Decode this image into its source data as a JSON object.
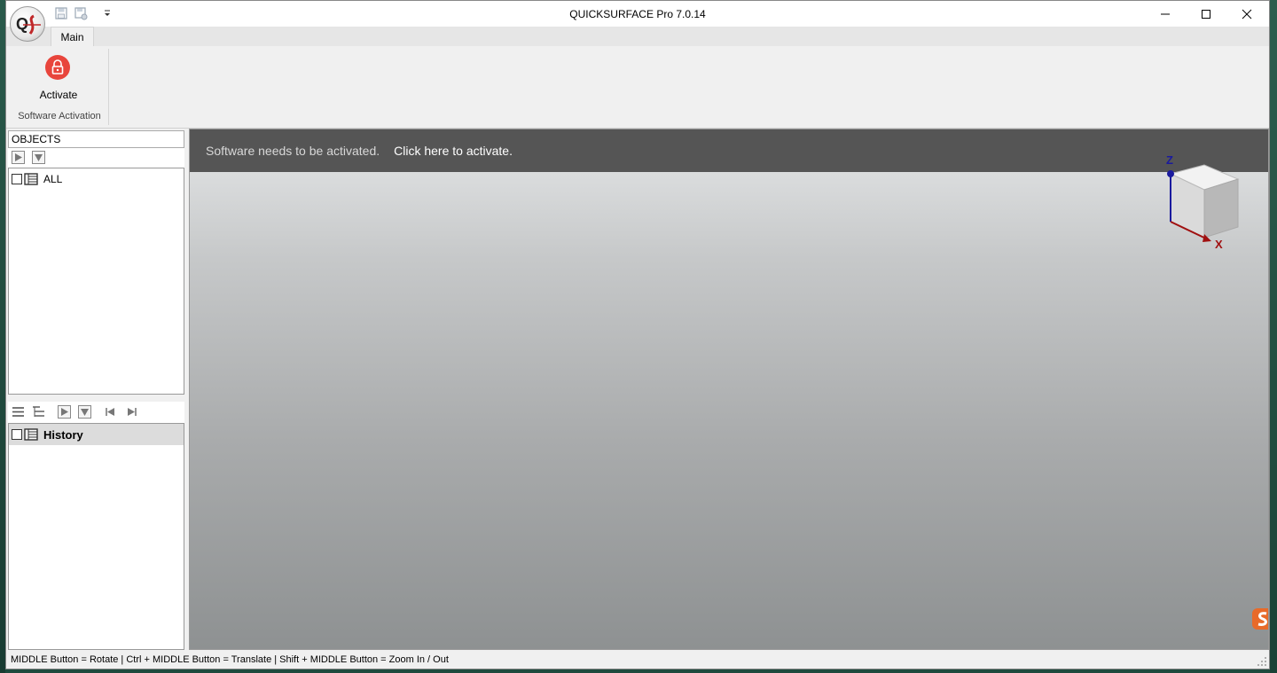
{
  "window": {
    "title": "QUICKSURFACE Pro 7.0.14"
  },
  "tabs": [
    {
      "label": "Main",
      "active": true
    }
  ],
  "ribbon": {
    "activate_label": "Activate",
    "group_label": "Software Activation"
  },
  "objects": {
    "header": "OBJECTS",
    "tree": [
      {
        "label": "ALL"
      }
    ]
  },
  "history": {
    "title": "History"
  },
  "viewport": {
    "banner_message": "Software needs to be activated.",
    "banner_link": "Click here to activate.",
    "axis_z": "Z",
    "axis_x": "X"
  },
  "status": {
    "text": "MIDDLE Button = Rotate | Ctrl + MIDDLE Button = Translate | Shift + MIDDLE Button = Zoom In / Out"
  },
  "colors": {
    "accent_red": "#e8453c",
    "banner_bg": "#555555",
    "axis_blue": "#1a1a9e",
    "axis_red": "#a01010"
  },
  "icons": [
    "app-logo-icon",
    "save-icon",
    "save-as-icon",
    "customize-dropdown-icon",
    "minimize-icon",
    "maximize-icon",
    "close-icon",
    "lock-icon",
    "play-icon",
    "filter-icon",
    "list-icon",
    "tree-icon",
    "first-icon",
    "last-icon",
    "view-cube-icon",
    "side-badge-icon"
  ]
}
